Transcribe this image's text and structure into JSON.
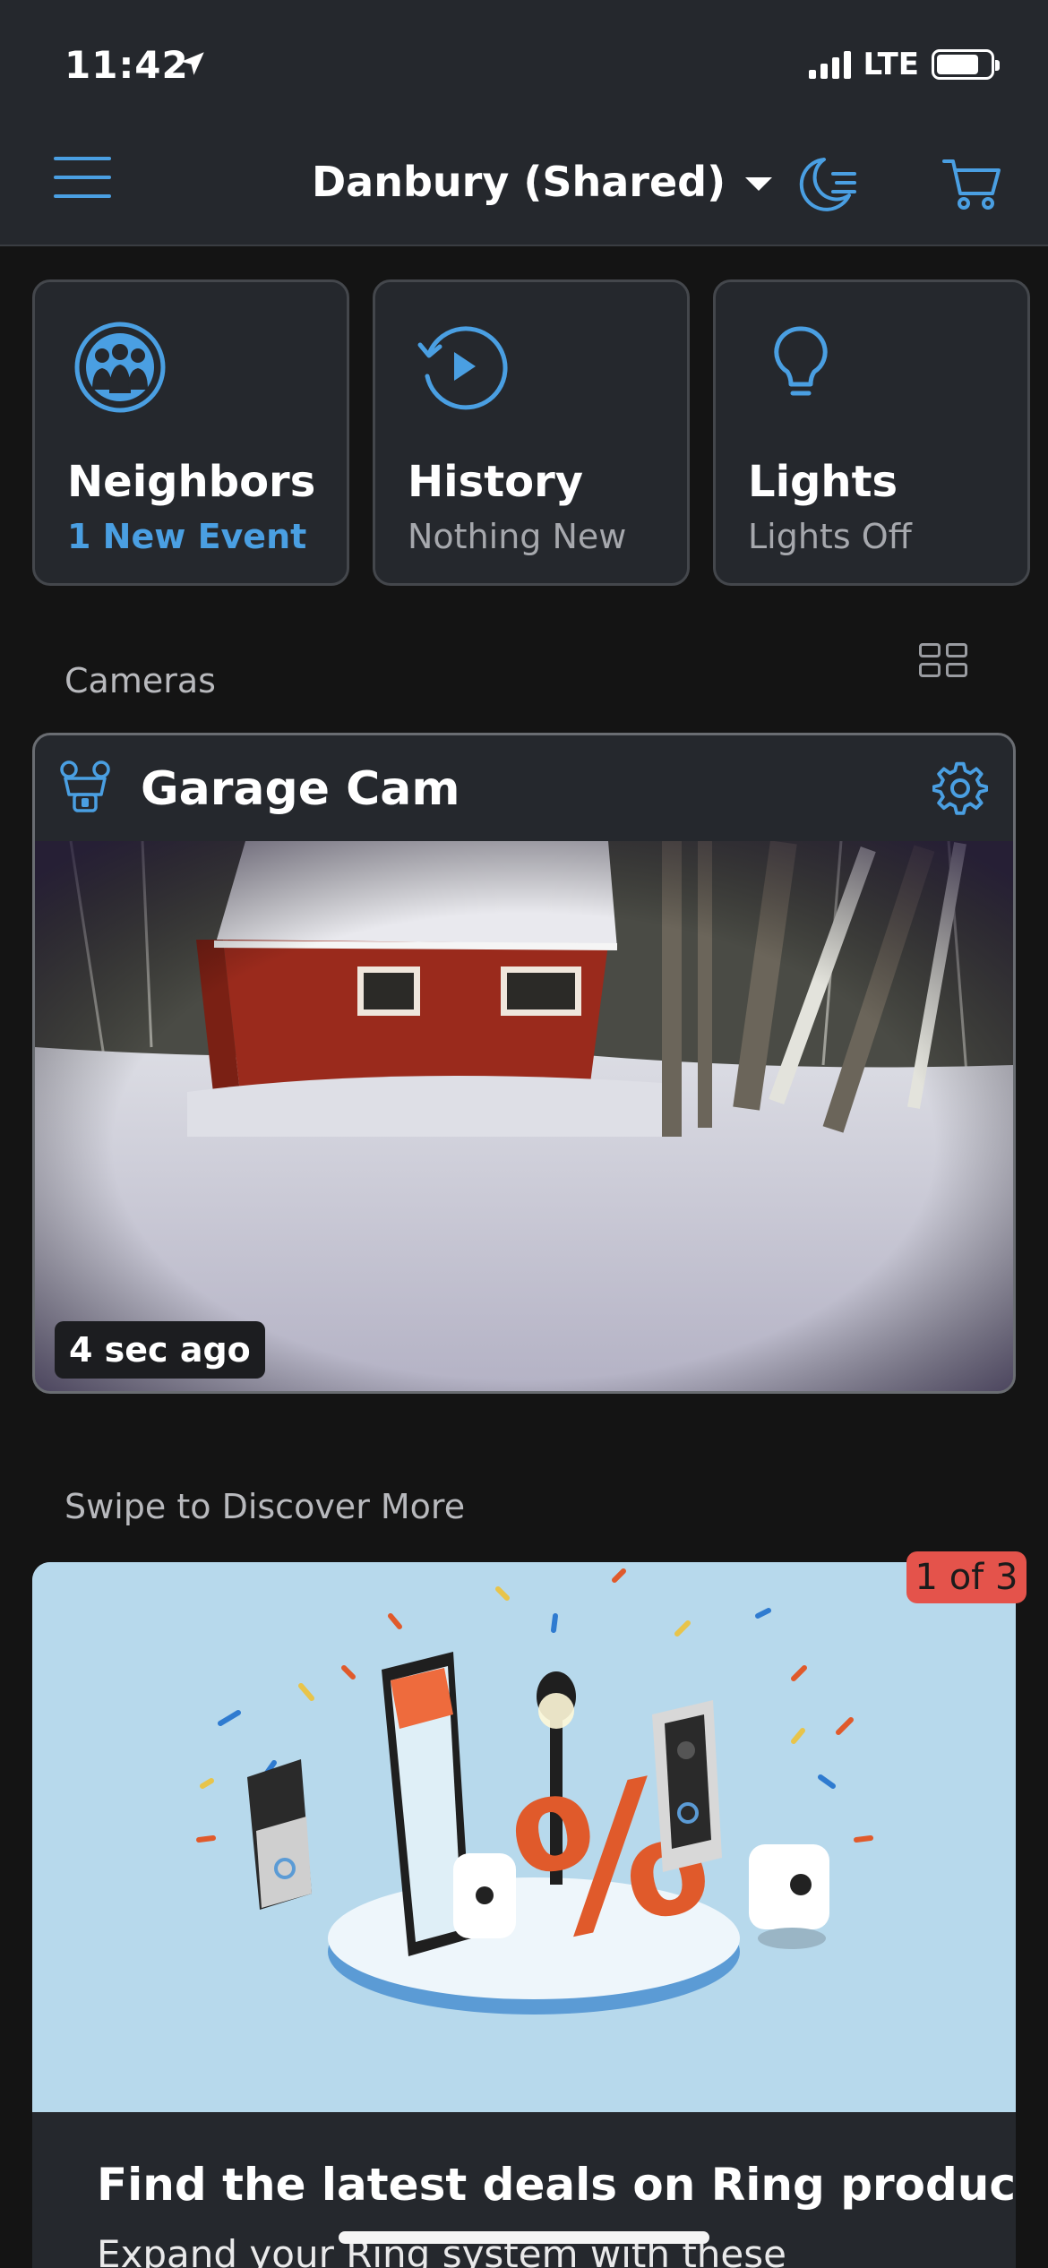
{
  "status_bar": {
    "time": "11:42",
    "network": "LTE",
    "battery_level": 0.8
  },
  "header": {
    "location": "Danbury (Shared)",
    "icons": [
      "menu-icon",
      "moon-mode-icon",
      "cart-icon"
    ]
  },
  "tiles": [
    {
      "title": "Neighbors",
      "subtitle": "1 New Event",
      "icon": "neighbors-icon"
    },
    {
      "title": "History",
      "subtitle": "Nothing New",
      "icon": "history-play-icon"
    },
    {
      "title": "Lights",
      "subtitle": "Lights Off",
      "icon": "lightbulb-icon"
    }
  ],
  "cameras": {
    "section_label": "Cameras",
    "items": [
      {
        "name": "Garage Cam",
        "snapshot_age": "4 sec ago",
        "icon": "camera-icon"
      }
    ]
  },
  "discover": {
    "section_label": "Swipe to Discover More",
    "page_indicator": "1 of 3",
    "promo_title": "Find the latest deals on Ring products.",
    "promo_subtitle": "Expand your Ring system with these"
  },
  "colors": {
    "accent": "#4a9fe2",
    "badge": "#e4534b",
    "background": "#141414",
    "card": "#25282d"
  }
}
